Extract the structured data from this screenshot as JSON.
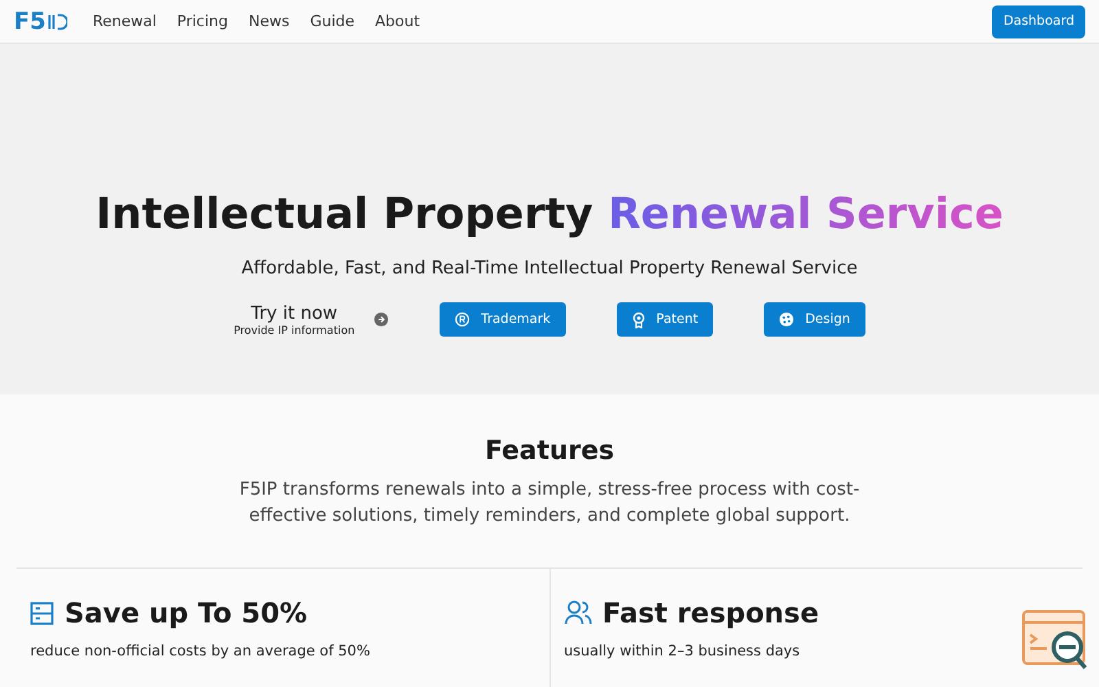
{
  "nav": {
    "logo": "F5",
    "links": [
      "Renewal",
      "Pricing",
      "News",
      "Guide",
      "About"
    ],
    "button": "Dashboard"
  },
  "hero": {
    "title": "Intellectual Property",
    "highlight": "Renewal Service",
    "subtitle": "Affordable, Fast, and Real-Time Intellectual Property Renewal Service",
    "try_title": "Try it now",
    "try_sub": "Provide IP information",
    "buttons": [
      {
        "kind": "trademark",
        "label": "Trademark"
      },
      {
        "kind": "patent",
        "label": "Patent"
      },
      {
        "kind": "design",
        "label": "Design"
      }
    ]
  },
  "features": {
    "title": "Features",
    "text": "F5IP transforms renewals into a simple, stress-free process with cost-effective solutions, timely reminders, and complete global support.",
    "cards": [
      {
        "kind": "savings",
        "title": "Save up To 50%",
        "text": "reduce non-official costs by an average of 50%"
      },
      {
        "kind": "response",
        "title": "Fast response",
        "text": "usually within 2–3 business days"
      }
    ]
  }
}
